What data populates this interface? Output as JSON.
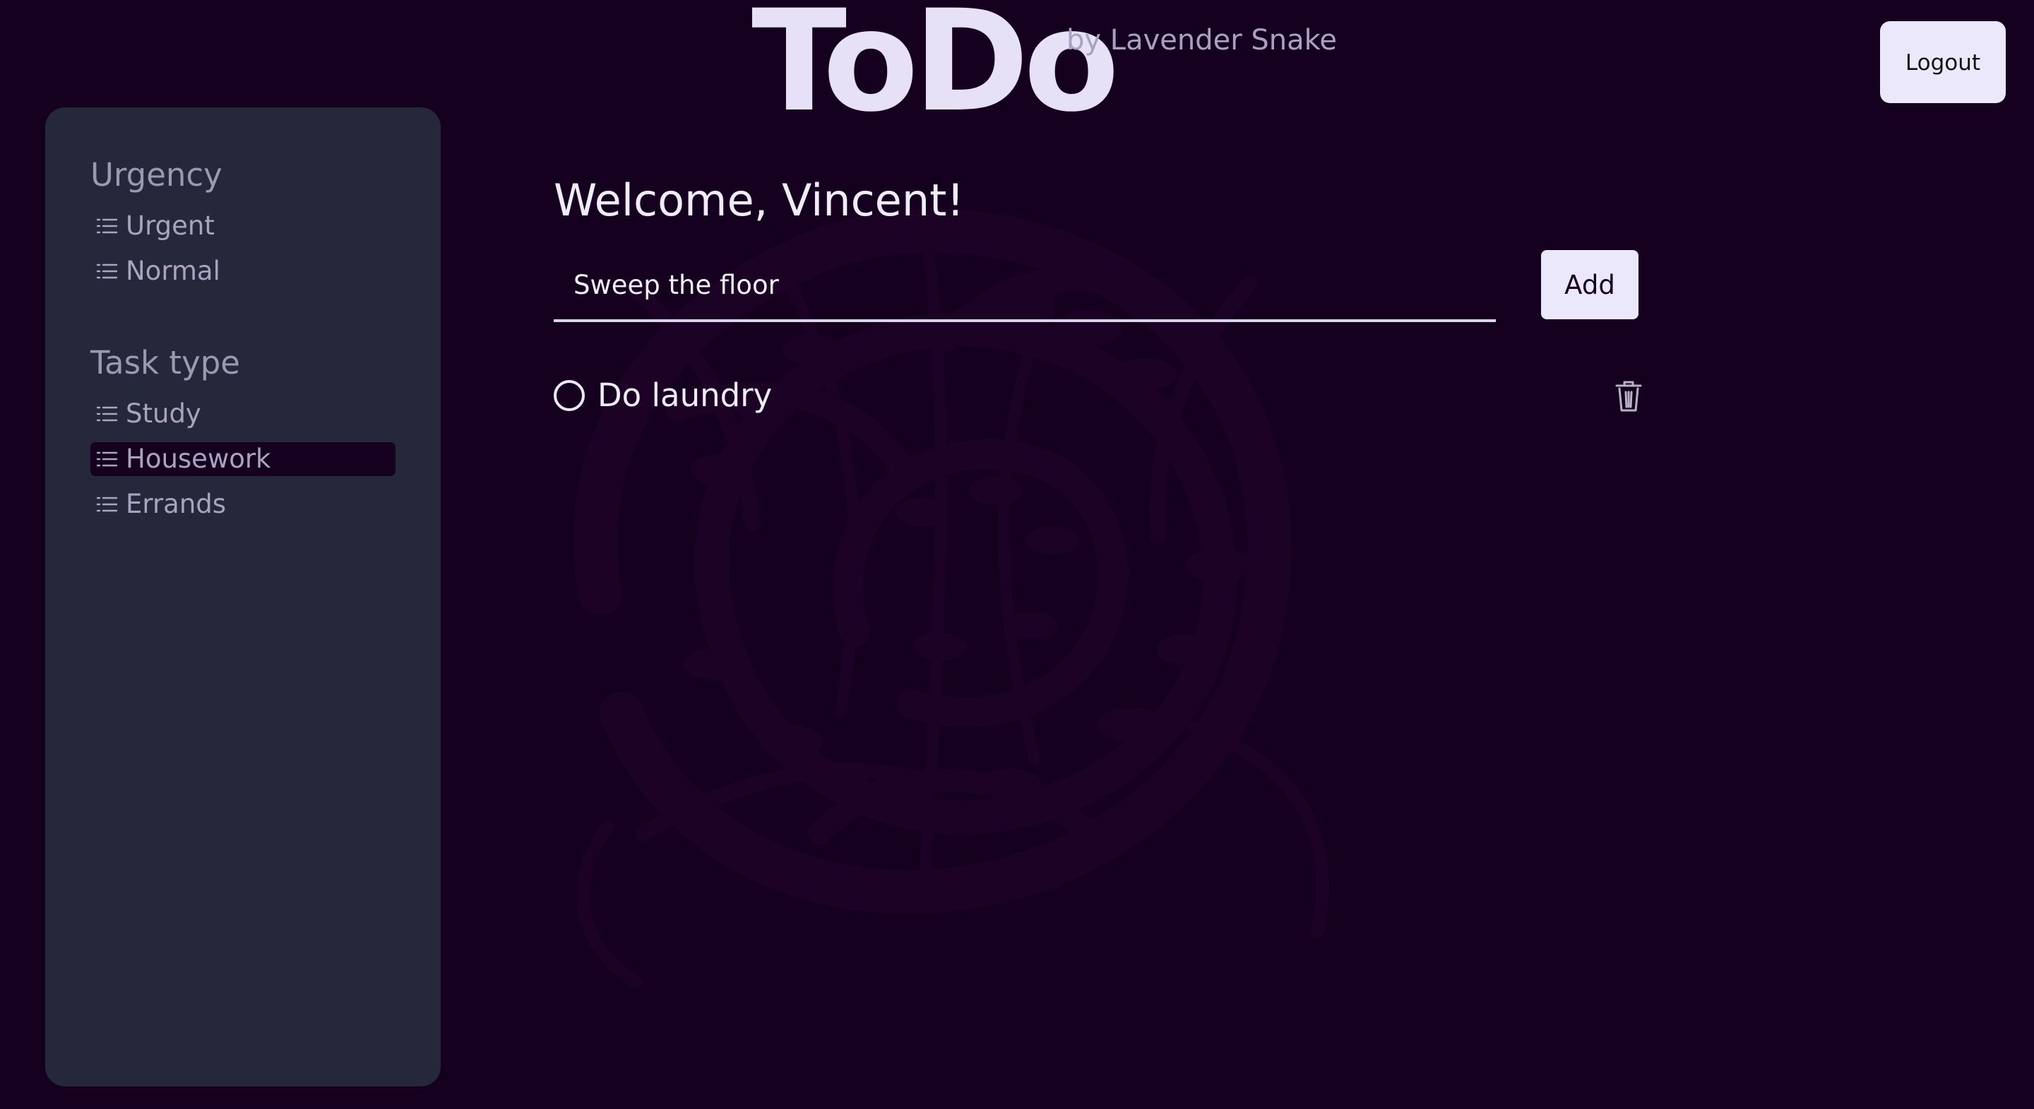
{
  "brand": {
    "title": "ToDo",
    "subtitle": "by Lavender Snake"
  },
  "header": {
    "logout_label": "Logout"
  },
  "sidebar": {
    "groups": [
      {
        "heading": "Urgency",
        "items": [
          {
            "label": "Urgent",
            "icon": "list-icon",
            "active": false
          },
          {
            "label": "Normal",
            "icon": "list-icon",
            "active": false
          }
        ]
      },
      {
        "heading": "Task type",
        "items": [
          {
            "label": "Study",
            "icon": "list-icon",
            "active": false
          },
          {
            "label": "Housework",
            "icon": "list-icon",
            "active": true
          },
          {
            "label": "Errands",
            "icon": "list-icon",
            "active": false
          }
        ]
      }
    ]
  },
  "main": {
    "welcome": "Welcome, Vincent!",
    "task_input": {
      "value": "Sweep the floor"
    },
    "add_label": "Add",
    "tasks": [
      {
        "label": "Do laundry",
        "completed": false,
        "delete_icon": "trash-icon"
      }
    ]
  },
  "colors": {
    "background": "#16001f",
    "sidebar": "#25273a",
    "accent": "#ebe8fb",
    "muted_text": "#a8a4c0"
  }
}
